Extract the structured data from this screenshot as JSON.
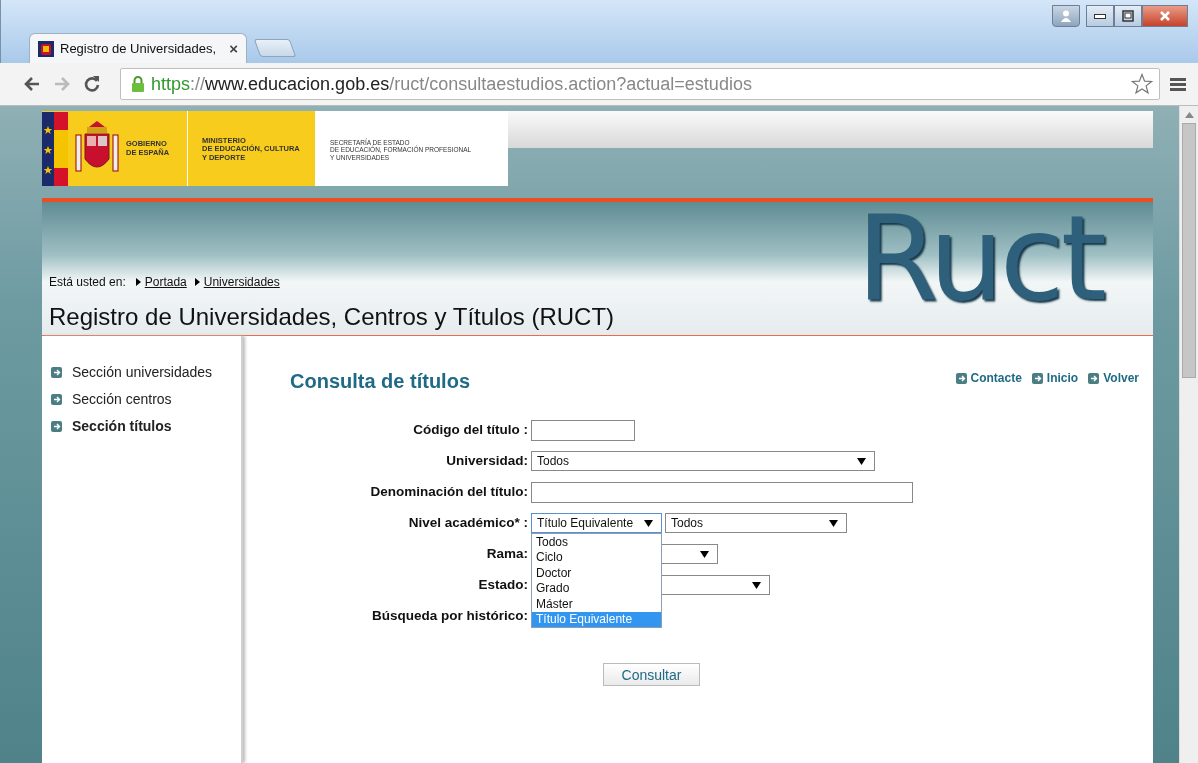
{
  "browser": {
    "tab_title": "Registro de Universidades,",
    "tab_close": "×",
    "url": {
      "scheme": "https",
      "separator": "://",
      "host": "www.educacion.gob.es",
      "path": "/ruct/consultaestudios.action?actual=estudios"
    }
  },
  "header": {
    "gobierno": [
      "GOBIERNO",
      "DE ESPAÑA"
    ],
    "ministerio": [
      "MINISTERIO",
      "DE EDUCACIÓN, CULTURA",
      "Y DEPORTE"
    ],
    "secretaria": [
      "SECRETARÍA DE ESTADO",
      "DE EDUCACIÓN, FORMACIÓN PROFESIONAL",
      "Y UNIVERSIDADES"
    ]
  },
  "banner": {
    "breadcrumb_label": "Está usted en:",
    "breadcrumb": [
      "Portada",
      "Universidades"
    ],
    "site_title": "Registro de Universidades, Centros y Títulos (RUCT)",
    "logo": "Ruct"
  },
  "sidebar": {
    "items": [
      {
        "label": "Sección universidades",
        "selected": false
      },
      {
        "label": "Sección centros",
        "selected": false
      },
      {
        "label": "Sección títulos",
        "selected": true
      }
    ]
  },
  "main": {
    "heading": "Consulta de títulos",
    "links": [
      "Contacte",
      "Inicio",
      "Volver"
    ],
    "form": [
      {
        "kind": "text",
        "label": "Código del título :"
      },
      {
        "kind": "select",
        "label": "Universidad:",
        "value": "Todos"
      },
      {
        "kind": "text",
        "label": "Denominación del título:"
      },
      {
        "kind": "select_pair",
        "label": "Nivel académico* :",
        "value": "Título Equivalente",
        "open": true,
        "options": [
          {
            "label": "Todos",
            "selected": false
          },
          {
            "label": "Ciclo",
            "selected": false
          },
          {
            "label": "Doctor",
            "selected": false
          },
          {
            "label": "Grado",
            "selected": false
          },
          {
            "label": "Máster",
            "selected": false
          },
          {
            "label": "Título Equivalente",
            "selected": true
          }
        ],
        "second_value": "Todos"
      },
      {
        "kind": "select",
        "label": "Rama:"
      },
      {
        "kind": "select",
        "label": "Estado:"
      },
      {
        "kind": "covered",
        "label": "Búsqueda por histórico:"
      }
    ],
    "submit": "Consultar"
  }
}
